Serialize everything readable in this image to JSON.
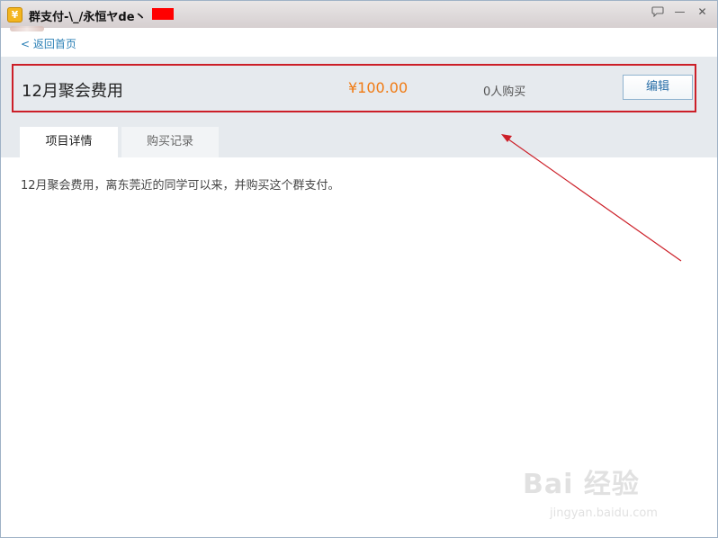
{
  "window": {
    "title": "群支付-\\_/永恒ヤde丶",
    "app_icon": "¥",
    "controls": {
      "chat": "chat-bubble-icon",
      "minimize": "—",
      "close": "✕"
    }
  },
  "nav": {
    "back_label": "< 返回首页"
  },
  "item": {
    "name": "12月聚会费用",
    "price": "¥100.00",
    "buyers": "0人购买",
    "edit_label": "编辑"
  },
  "tabs": [
    {
      "label": "项目详情",
      "active": true
    },
    {
      "label": "购买记录",
      "active": false
    }
  ],
  "details": {
    "description": "12月聚会费用，离东莞近的同学可以来，并购买这个群支付。"
  },
  "watermark": {
    "brand": "Bai 经验",
    "url": "jingyan.baidu.com"
  },
  "colors": {
    "price": "#f07a12",
    "highlight_border": "#cc1f28",
    "link": "#2a7fb5",
    "panel_bg": "#e6eaee"
  }
}
